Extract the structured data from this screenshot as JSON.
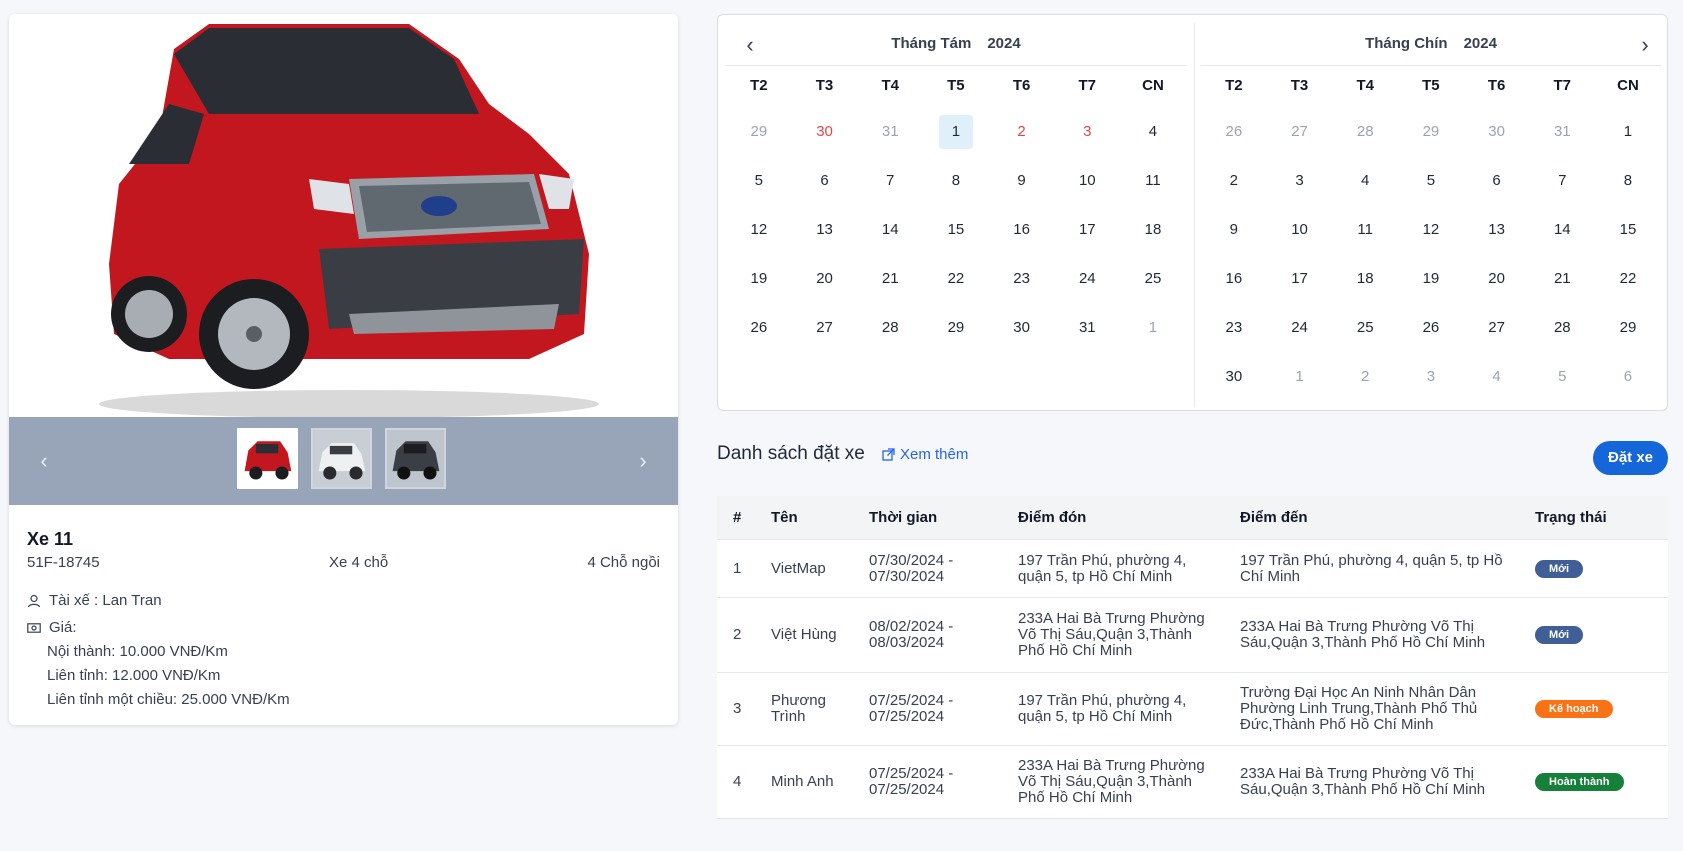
{
  "car": {
    "name": "Xe 11",
    "plate": "51F-18745",
    "type": "Xe 4 chỗ",
    "seats": "4 Chỗ ngồi",
    "driver": "Tài xế : Lan Tran",
    "price_label": "Giá:",
    "prices": [
      "Nội thành: 10.000 VNĐ/Km",
      "Liên tỉnh: 12.000 VNĐ/Km",
      "Liên tỉnh một chiều: 25.000 VNĐ/Km"
    ],
    "colors": {
      "strip": "#98a4b7"
    },
    "icons": {
      "driver": "user-icon",
      "price": "money-icon",
      "prev": "chevron-left-icon",
      "next": "chevron-right-icon"
    }
  },
  "calendar": {
    "months": [
      {
        "name": "Tháng Tám",
        "year": "2024",
        "weekdays": [
          "T2",
          "T3",
          "T4",
          "T5",
          "T6",
          "T7",
          "CN"
        ],
        "days": [
          {
            "d": "29",
            "s": "muted"
          },
          {
            "d": "30",
            "s": "red"
          },
          {
            "d": "31",
            "s": "muted"
          },
          {
            "d": "1",
            "s": "today"
          },
          {
            "d": "2",
            "s": "red"
          },
          {
            "d": "3",
            "s": "red"
          },
          {
            "d": "4",
            "s": ""
          },
          {
            "d": "5",
            "s": ""
          },
          {
            "d": "6",
            "s": ""
          },
          {
            "d": "7",
            "s": ""
          },
          {
            "d": "8",
            "s": ""
          },
          {
            "d": "9",
            "s": ""
          },
          {
            "d": "10",
            "s": ""
          },
          {
            "d": "11",
            "s": ""
          },
          {
            "d": "12",
            "s": ""
          },
          {
            "d": "13",
            "s": ""
          },
          {
            "d": "14",
            "s": ""
          },
          {
            "d": "15",
            "s": ""
          },
          {
            "d": "16",
            "s": ""
          },
          {
            "d": "17",
            "s": ""
          },
          {
            "d": "18",
            "s": ""
          },
          {
            "d": "19",
            "s": ""
          },
          {
            "d": "20",
            "s": ""
          },
          {
            "d": "21",
            "s": ""
          },
          {
            "d": "22",
            "s": ""
          },
          {
            "d": "23",
            "s": ""
          },
          {
            "d": "24",
            "s": ""
          },
          {
            "d": "25",
            "s": ""
          },
          {
            "d": "26",
            "s": ""
          },
          {
            "d": "27",
            "s": ""
          },
          {
            "d": "28",
            "s": ""
          },
          {
            "d": "29",
            "s": ""
          },
          {
            "d": "30",
            "s": ""
          },
          {
            "d": "31",
            "s": ""
          },
          {
            "d": "1",
            "s": "muted"
          }
        ]
      },
      {
        "name": "Tháng Chín",
        "year": "2024",
        "weekdays": [
          "T2",
          "T3",
          "T4",
          "T5",
          "T6",
          "T7",
          "CN"
        ],
        "days": [
          {
            "d": "26",
            "s": "muted"
          },
          {
            "d": "27",
            "s": "muted"
          },
          {
            "d": "28",
            "s": "muted"
          },
          {
            "d": "29",
            "s": "muted"
          },
          {
            "d": "30",
            "s": "muted"
          },
          {
            "d": "31",
            "s": "muted"
          },
          {
            "d": "1",
            "s": ""
          },
          {
            "d": "2",
            "s": ""
          },
          {
            "d": "3",
            "s": ""
          },
          {
            "d": "4",
            "s": ""
          },
          {
            "d": "5",
            "s": ""
          },
          {
            "d": "6",
            "s": ""
          },
          {
            "d": "7",
            "s": ""
          },
          {
            "d": "8",
            "s": ""
          },
          {
            "d": "9",
            "s": ""
          },
          {
            "d": "10",
            "s": ""
          },
          {
            "d": "11",
            "s": ""
          },
          {
            "d": "12",
            "s": ""
          },
          {
            "d": "13",
            "s": ""
          },
          {
            "d": "14",
            "s": ""
          },
          {
            "d": "15",
            "s": ""
          },
          {
            "d": "16",
            "s": ""
          },
          {
            "d": "17",
            "s": ""
          },
          {
            "d": "18",
            "s": ""
          },
          {
            "d": "19",
            "s": ""
          },
          {
            "d": "20",
            "s": ""
          },
          {
            "d": "21",
            "s": ""
          },
          {
            "d": "22",
            "s": ""
          },
          {
            "d": "23",
            "s": ""
          },
          {
            "d": "24",
            "s": ""
          },
          {
            "d": "25",
            "s": ""
          },
          {
            "d": "26",
            "s": ""
          },
          {
            "d": "27",
            "s": ""
          },
          {
            "d": "28",
            "s": ""
          },
          {
            "d": "29",
            "s": ""
          },
          {
            "d": "30",
            "s": ""
          },
          {
            "d": "1",
            "s": "muted"
          },
          {
            "d": "2",
            "s": "muted"
          },
          {
            "d": "3",
            "s": "muted"
          },
          {
            "d": "4",
            "s": "muted"
          },
          {
            "d": "5",
            "s": "muted"
          },
          {
            "d": "6",
            "s": "muted"
          }
        ]
      }
    ]
  },
  "bookings": {
    "title": "Danh sách đặt xe",
    "see_more": "Xem thêm",
    "book_button": "Đặt xe",
    "columns": [
      "#",
      "Tên",
      "Thời gian",
      "Điểm đón",
      "Điểm đến",
      "Trạng thái"
    ],
    "rows": [
      {
        "num": "1",
        "name": "VietMap",
        "time": "07/30/2024 -\n07/30/2024",
        "from": "197 Trần Phú, phường 4,\nquận 5, tp Hồ Chí Minh",
        "to": "197 Trần Phú, phường 4, quận 5, tp Hồ\nChí Minh",
        "status": "Mới",
        "status_color": "#3f5f96"
      },
      {
        "num": "2",
        "name": "Việt Hùng",
        "time": "08/02/2024 -\n08/03/2024",
        "from": "233A Hai Bà Trưng Phường\nVõ Thị Sáu,Quận 3,Thành\nPhố Hồ Chí Minh",
        "to": "233A Hai Bà Trưng Phường Võ Thị\nSáu,Quận 3,Thành Phố Hồ Chí Minh",
        "status": "Mới",
        "status_color": "#3f5f96"
      },
      {
        "num": "3",
        "name": "Phương\nTrình",
        "time": "07/25/2024 -\n07/25/2024",
        "from": "197 Trần Phú, phường 4,\nquận 5, tp Hồ Chí Minh",
        "to": "Trường Đại Học An Ninh Nhân Dân\nPhường Linh Trung,Thành Phố Thủ\nĐức,Thành Phố Hồ Chí Minh",
        "status": "Kế hoạch",
        "status_color": "#f97316"
      },
      {
        "num": "4",
        "name": "Minh Anh",
        "time": "07/25/2024 -\n07/25/2024",
        "from": "233A Hai Bà Trưng Phường\nVõ Thị Sáu,Quận 3,Thành\nPhố Hồ Chí Minh",
        "to": "233A Hai Bà Trưng Phường Võ Thị\nSáu,Quận 3,Thành Phố Hồ Chí Minh",
        "status": "Hoàn thành",
        "status_color": "#16803a"
      }
    ]
  },
  "colors": {
    "accent": "#1466d9",
    "link": "#2563eb",
    "holiday": "#e04848",
    "today_bg": "#e0f0fb"
  }
}
